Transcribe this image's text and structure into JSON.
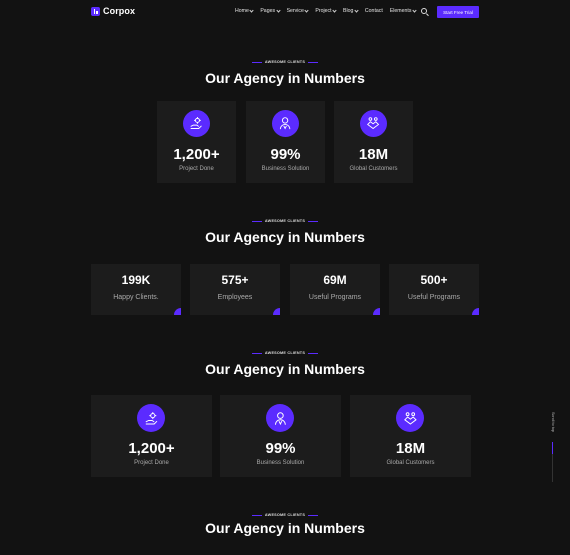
{
  "header": {
    "logo_text": "Corpox",
    "nav": [
      {
        "label": "Home",
        "dropdown": true
      },
      {
        "label": "Pages",
        "dropdown": true
      },
      {
        "label": "Service",
        "dropdown": true
      },
      {
        "label": "Project",
        "dropdown": true
      },
      {
        "label": "Blog",
        "dropdown": true
      },
      {
        "label": "Contact",
        "dropdown": false
      },
      {
        "label": "Elements",
        "dropdown": true
      }
    ],
    "cta_label": "Start Free Trial"
  },
  "sections": [
    {
      "tag": "AWESOME CLIENTS",
      "title": "Our Agency in Numbers",
      "stats": [
        {
          "value": "1,200+",
          "label": "Project Done",
          "icon": "gear-hand-icon"
        },
        {
          "value": "99%",
          "label": "Business Solution",
          "icon": "person-badge-icon"
        },
        {
          "value": "18M",
          "label": "Global Customers",
          "icon": "handshake-icon"
        }
      ]
    },
    {
      "tag": "AWESOME CLIENTS",
      "title": "Our Agency in Numbers",
      "stats": [
        {
          "value": "199K",
          "label": "Happy Clients."
        },
        {
          "value": "575+",
          "label": "Employees"
        },
        {
          "value": "69M",
          "label": "Useful Programs"
        },
        {
          "value": "500+",
          "label": "Useful Programs"
        }
      ]
    },
    {
      "tag": "AWESOME CLIENTS",
      "title": "Our Agency in Numbers",
      "stats": [
        {
          "value": "1,200+",
          "label": "Project Done",
          "icon": "gear-hand-icon"
        },
        {
          "value": "99%",
          "label": "Business Solution",
          "icon": "person-badge-icon"
        },
        {
          "value": "18M",
          "label": "Global Customers",
          "icon": "handshake-icon"
        }
      ]
    },
    {
      "tag": "AWESOME CLIENTS",
      "title": "Our Agency in Numbers"
    }
  ],
  "scroll_top_label": "Scroll to top",
  "colors": {
    "accent": "#5b2bff",
    "background": "#121212",
    "card": "#1c1c1c"
  }
}
